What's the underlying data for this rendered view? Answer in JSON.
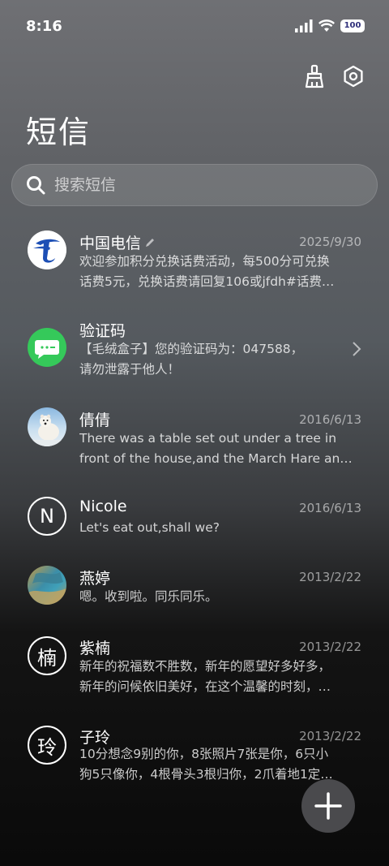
{
  "status_bar": {
    "time": "8:16",
    "battery": "100",
    "icons": [
      "signal-icon",
      "wifi-icon",
      "battery-icon"
    ]
  },
  "header": {
    "title": "短信",
    "actions": [
      "broom-icon",
      "settings-hex-icon"
    ]
  },
  "search": {
    "placeholder": "搜索短信"
  },
  "conversations": [
    {
      "name": "中国电信",
      "date": "2025/9/30",
      "line1": "欢迎参加积分兑换话费活动，每500分可兑换",
      "line2": "话费5元，兑换话费请回复106或jfdh#话费…",
      "avatar": "china-telecom-logo",
      "edit_icon": "pencil-icon"
    },
    {
      "name": "验证码",
      "date": "",
      "line1": "【毛绒盒子】您的验证码为：047588，",
      "line2": "请勿泄露于他人！",
      "avatar": "message-bubble-icon",
      "chevron": "chevron-right-icon"
    },
    {
      "name": "倩倩",
      "date": "2016/6/13",
      "line1": "There was a table set out under a tree in",
      "line2": "front of the house,and the March Hare an…",
      "avatar": "polar-bear-photo"
    },
    {
      "name": "Nicole",
      "date": "2016/6/13",
      "line1": "Let's eat out,shall we?",
      "line2": "",
      "avatar_letter": "N"
    },
    {
      "name": "燕婷",
      "date": "2013/2/22",
      "line1": "嗯。收到啦。同乐同乐。",
      "line2": "",
      "avatar": "landscape-photo"
    },
    {
      "name": "紫楠",
      "date": "2013/2/22",
      "line1": "新年的祝福数不胜数，新年的愿望好多好多，",
      "line2": "新年的问候依旧美好，在这个温馨的时刻，…",
      "avatar_letter": "楠"
    },
    {
      "name": "子玲",
      "date": "2013/2/22",
      "line1": "10分想念9别的你，8张照片7张是你，6只小",
      "line2": "狗5只像你，4根骨头3根归你，2爪着地1定…",
      "avatar_letter": "玲"
    }
  ],
  "fab": {
    "icon": "plus-icon"
  },
  "colors": {
    "avatar_green": "#35c95a",
    "telecom_blue": "#1d4fb5",
    "fab_bg": "#4a4a4d"
  }
}
